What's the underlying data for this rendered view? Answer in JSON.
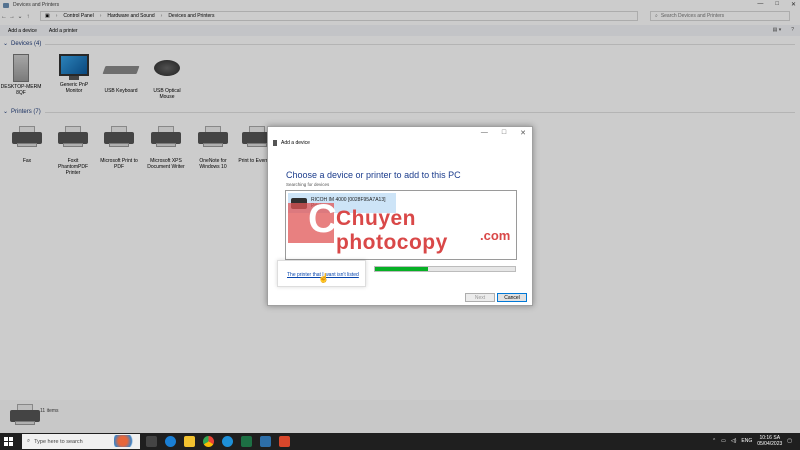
{
  "window": {
    "title": "Devices and Printers",
    "controls": [
      "—",
      "□",
      "✕"
    ]
  },
  "address": {
    "crumbs": [
      "Control Panel",
      "Hardware and Sound",
      "Devices and Printers"
    ],
    "search_placeholder": "Search Devices and Printers"
  },
  "toolbar": {
    "add_device": "Add a device",
    "add_printer": "Add a printer",
    "view_icon": "view-options-icon",
    "help_icon": "help-icon"
  },
  "devices": {
    "header": "Devices (4)",
    "items": [
      {
        "label": "DESKTOP-MERM 8QF",
        "icon": "computer-tower-icon"
      },
      {
        "label": "Generic PnP Monitor",
        "icon": "monitor-icon"
      },
      {
        "label": "USB Keyboard",
        "icon": "keyboard-icon"
      },
      {
        "label": "USB Optical Mouse",
        "icon": "mouse-icon"
      }
    ]
  },
  "printers": {
    "header": "Printers (7)",
    "items": [
      {
        "label": "Fax",
        "icon": "fax-icon"
      },
      {
        "label": "Foxit PhantomPDF Printer",
        "icon": "printer-icon"
      },
      {
        "label": "Microsoft Print to PDF",
        "icon": "printer-icon"
      },
      {
        "label": "Microsoft XPS Document Writer",
        "icon": "printer-icon"
      },
      {
        "label": "OneNote for Windows 10",
        "icon": "printer-icon"
      },
      {
        "label": "Print to Evernote",
        "icon": "printer-icon"
      }
    ]
  },
  "statusbar": {
    "count": "11 items"
  },
  "dialog": {
    "title": "Add a device",
    "heading": "Choose a device or printer to add to this PC",
    "subtitle": "Searching for devices",
    "device": {
      "name": "RICOH IM 4000 [0028F95A7A13]",
      "type": "Printer"
    },
    "progress": 0.38,
    "link": "The printer that I want isn't listed",
    "next": "Next",
    "cancel": "Cancel",
    "controls": [
      "—",
      "□",
      "✕"
    ]
  },
  "watermark": {
    "text": "Chuyen photocopy",
    "suffix": ".com"
  },
  "taskbar": {
    "search_placeholder": "Type here to search",
    "lang": "ENG",
    "time": "10:16 SA",
    "date": "05/04/2023"
  }
}
